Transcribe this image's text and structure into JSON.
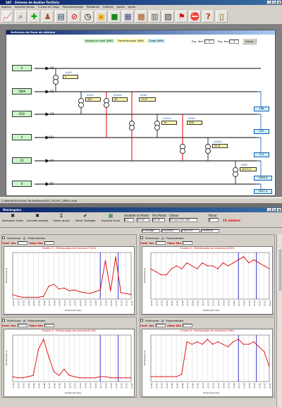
{
  "app": {
    "title": "SAT - Sistema de Análise Tarifária",
    "menu": [
      "Arquivo",
      "Importar Dados",
      "Curvas de Carga",
      "Processamentos",
      "Relatórios",
      "Gráficos",
      "Janela",
      "Ajuda"
    ],
    "toolbar_icons": [
      "chart-tool-icon",
      "magnifier-icon",
      "add-icon",
      "person-icon",
      "table-icon",
      "no-entry-icon",
      "clock-icon",
      "color-box-icon",
      "cube-icon",
      "grid-icon",
      "boxes-icon",
      "film-icon",
      "calculator-icon",
      "flag-icon",
      "barrier-icon",
      "question-icon",
      "exit-door-icon"
    ],
    "status_path": "C:\\Mario\\Fiho\\Celesc-Tarifas\\Bases\\SAT_CELESC_AREEL.mdb"
  },
  "flow": {
    "title": "Definição do fluxo do sistema",
    "legend": {
      "injecao": "Injeção no nível (MW)",
      "transformacao": "Transformação (MW)",
      "carga": "Carga (MW)"
    },
    "esp_vert_label": "Esp. Vert.",
    "esp_vert_value": "3",
    "esp_hor_label": "Esp. Hor.",
    "esp_hor_value": "3",
    "save_label": "Salvar",
    "levels": [
      {
        "label": "A0",
        "injection": "0"
      },
      {
        "label": "A2",
        "injection": "1849"
      },
      {
        "label": "A3",
        "injection": "610"
      },
      {
        "label": "A3a",
        "injection": "0"
      },
      {
        "label": "A4",
        "injection": "21"
      },
      {
        "label": "BT",
        "injection": "0"
      }
    ],
    "transformers": [
      {
        "label": "A0A2",
        "value": "0"
      },
      {
        "label": "A2A3",
        "value": "481"
      },
      {
        "label": "A2A3a",
        "value": "43"
      },
      {
        "label": "A2A4",
        "value": "1147"
      },
      {
        "label": "A3A3a",
        "value": "10"
      },
      {
        "label": "A3A4",
        "value": "858"
      },
      {
        "label": "A3aA4",
        "value": "53,6"
      },
      {
        "label": "A4BT",
        "value": "1017,3"
      }
    ],
    "loads": [
      "166",
      "107",
      "3,4",
      "1063,3",
      "1017,3"
    ]
  },
  "hier": {
    "title": "Hierárquico",
    "tools": [
      {
        "icon": "✖",
        "label": "Selecionar todos"
      },
      {
        "icon": "✖",
        "label": "Cancelar seleção"
      },
      {
        "icon": "Σ",
        "label": "Somar grupo"
      },
      {
        "icon": "✔",
        "label": "Salvar Tipologia"
      },
      {
        "icon": "▦",
        "label": "Exportar Excel"
      }
    ],
    "unidade_label": "Unidade",
    "unidade_value": "d.u",
    "ini_label": "Ini.Ponto",
    "ini_value": "17:00",
    "fim_label": "Fim Ponto",
    "fim_value": "20:30",
    "classe_label": "Classe",
    "classe_value": "B1 com 201-400",
    "passo_label": "Passo",
    "passo_value": "5",
    "coef_values": [
      "0.000388",
      "0.209032",
      "0.633757",
      "1.009433"
    ],
    "clusters_label": "15 clusters",
    "select_label": "Selecionar",
    "props_label": "Propriedades",
    "coef_var_label": "Coef. Var.",
    "fator_dia_label": "Fator Dia",
    "y_axis_label": "Demanda [p.u]",
    "x_axis_label": "Horário [hh:mm]"
  },
  "chart_data": [
    {
      "type": "line",
      "title": "Cluster 3 - Participação de mercado 7,65%",
      "x": [
        "00:15",
        "01:15",
        "02:15",
        "03:15",
        "04:15",
        "05:15",
        "06:15",
        "07:15",
        "08:15",
        "09:15",
        "10:15",
        "11:15",
        "12:15",
        "13:15",
        "14:15",
        "15:15",
        "16:15",
        "17:15",
        "18:15",
        "19:15",
        "20:15",
        "21:15",
        "22:15",
        "23:15"
      ],
      "values": [
        0.5,
        0.3,
        0.2,
        0.2,
        0.2,
        0.2,
        0.3,
        1.4,
        1.6,
        1.1,
        1.2,
        0.9,
        1.0,
        0.8,
        0.7,
        0.6,
        0.8,
        1.0,
        4.2,
        0.9,
        4.6,
        0.7,
        0.6,
        0.5
      ]
    },
    {
      "type": "line",
      "title": "Cluster 4 - Participação de mercado 6,83%",
      "x": [
        "00:15",
        "01:15",
        "02:15",
        "03:15",
        "04:15",
        "05:15",
        "06:15",
        "07:15",
        "08:15",
        "09:15",
        "10:15",
        "11:15",
        "12:15",
        "13:15",
        "14:15",
        "15:15",
        "16:15",
        "17:15",
        "18:15",
        "19:15",
        "20:15",
        "21:15",
        "22:15",
        "23:15"
      ],
      "values": [
        0.5,
        0.45,
        0.4,
        0.4,
        0.5,
        0.55,
        0.5,
        0.6,
        0.55,
        0.5,
        0.6,
        0.55,
        0.55,
        0.5,
        0.6,
        0.55,
        0.6,
        0.65,
        0.7,
        0.6,
        0.65,
        0.6,
        0.55,
        0.5
      ]
    },
    {
      "type": "line",
      "title": "Cluster 5 - Participação de mercado 6,28%",
      "x": [
        "00:15",
        "01:15",
        "02:15",
        "03:15",
        "04:15",
        "05:15",
        "06:15",
        "07:15",
        "08:15",
        "09:15",
        "10:15",
        "11:15",
        "12:15",
        "13:15",
        "14:15",
        "15:15",
        "16:15",
        "17:15",
        "18:15",
        "19:15",
        "20:15",
        "21:15",
        "22:15",
        "23:15"
      ],
      "values": [
        0.4,
        0.3,
        0.3,
        0.4,
        0.5,
        2.6,
        3.4,
        2.0,
        0.8,
        0.5,
        1.0,
        0.5,
        0.4,
        0.3,
        0.3,
        0.3,
        0.3,
        0.4,
        0.4,
        0.3,
        0.3,
        0.3,
        0.3,
        0.3
      ]
    },
    {
      "type": "line",
      "title": "Cluster 6 - Participação de mercado 5,89%",
      "x": [
        "00:15",
        "01:15",
        "02:15",
        "03:15",
        "04:15",
        "05:15",
        "06:15",
        "07:15",
        "08:15",
        "09:15",
        "10:15",
        "11:15",
        "12:15",
        "13:15",
        "14:15",
        "15:15",
        "16:15",
        "17:15",
        "18:15",
        "19:15",
        "20:15",
        "21:15",
        "22:15",
        "23:15"
      ],
      "values": [
        0.2,
        0.2,
        0.2,
        0.2,
        0.2,
        0.2,
        0.3,
        1.6,
        1.5,
        1.6,
        1.5,
        1.7,
        1.5,
        1.6,
        1.5,
        1.4,
        1.6,
        1.7,
        1.5,
        1.5,
        1.6,
        1.4,
        1.2,
        0.6
      ]
    }
  ]
}
